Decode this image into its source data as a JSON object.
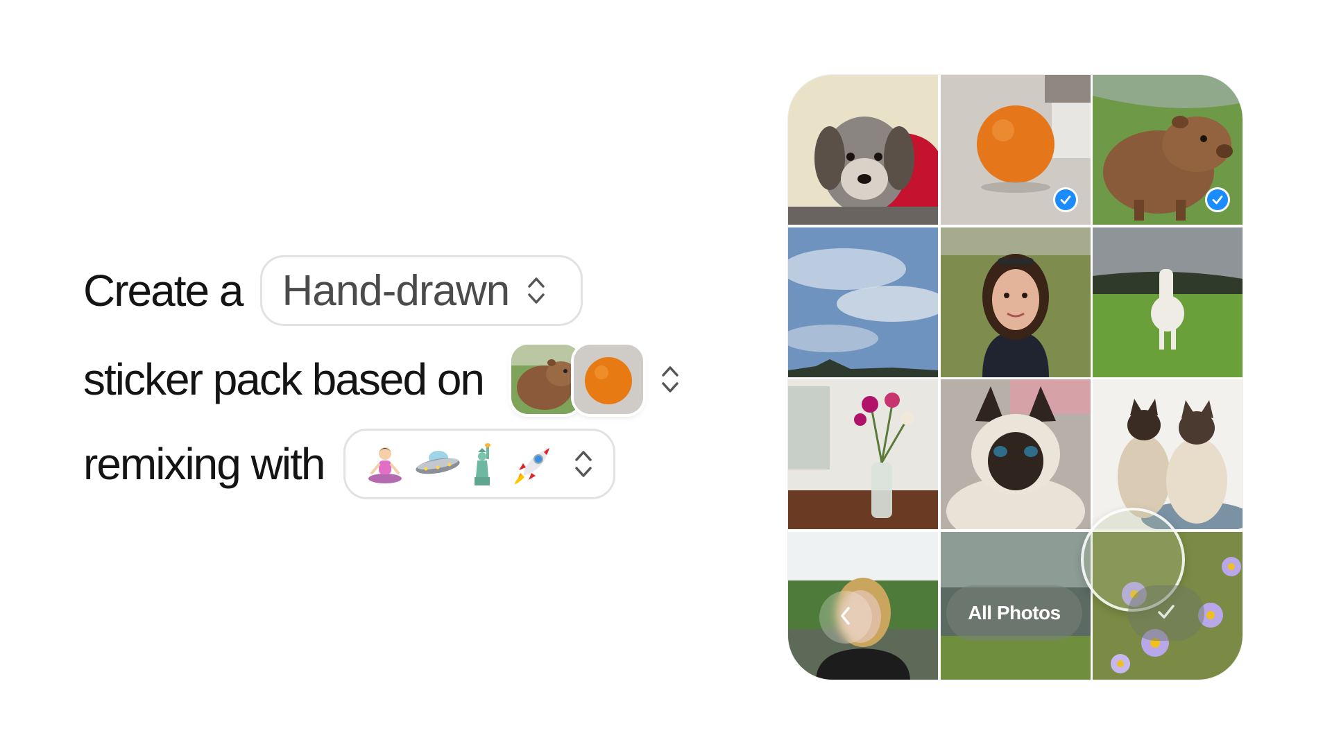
{
  "prompt": {
    "line1_prefix": "Create a",
    "style_select": {
      "value": "Hand-drawn"
    },
    "line2_prefix": "sticker pack based on",
    "selected_photos": [
      "capybara",
      "orange"
    ],
    "line3_prefix": "remixing with",
    "remix_emojis": [
      "person-in-lotus-position",
      "flying-saucer",
      "statue-of-liberty",
      "rocket"
    ]
  },
  "photo_grid": {
    "photos": [
      {
        "subject": "dog",
        "selected": false
      },
      {
        "subject": "orange",
        "selected": true
      },
      {
        "subject": "capybara",
        "selected": true
      },
      {
        "subject": "sky",
        "selected": false
      },
      {
        "subject": "woman-selfie",
        "selected": false
      },
      {
        "subject": "pony",
        "selected": false
      },
      {
        "subject": "flowers-vase",
        "selected": false
      },
      {
        "subject": "siamese-cat",
        "selected": false
      },
      {
        "subject": "two-siamese-cats",
        "selected": false
      },
      {
        "subject": "girl-portrait",
        "selected": false
      },
      {
        "subject": "pond",
        "selected": false
      },
      {
        "subject": "daisies",
        "selected": false
      }
    ],
    "all_photos_label": "All Photos"
  },
  "colors": {
    "check_blue": "#1a8cff",
    "chip_border": "#e2e2e2"
  }
}
